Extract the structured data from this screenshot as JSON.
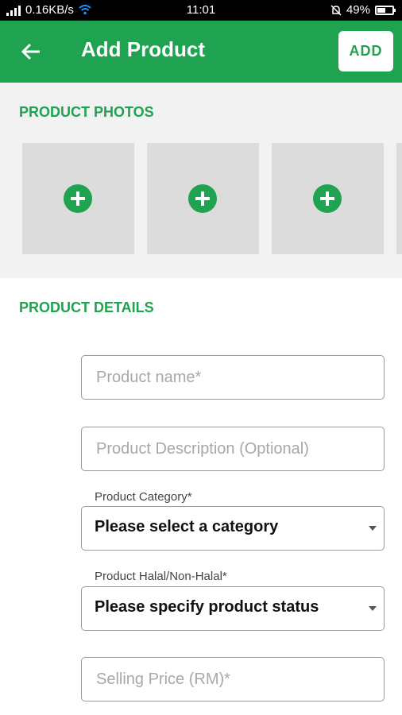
{
  "status_bar": {
    "network_speed": "0.16KB/s",
    "time": "11:01",
    "battery": "49%"
  },
  "app_bar": {
    "title": "Add Product",
    "add_label": "ADD",
    "back_icon": "arrow-left-icon"
  },
  "photos": {
    "heading": "PRODUCT PHOTOS",
    "add_icon": "plus-circle-icon"
  },
  "details": {
    "heading": "PRODUCT DETAILS",
    "product_name_placeholder": "Product name*",
    "description_placeholder": "Product Description (Optional)",
    "category_label": "Product Category*",
    "category_value": "Please select a category",
    "halal_label": "Product Halal/Non-Halal*",
    "halal_value": "Please specify product status",
    "price_placeholder": "Selling Price (RM)*"
  },
  "colors": {
    "accent": "#1fa351",
    "photo_slot": "#dcdcdc",
    "section_bg": "#f2f2f2"
  }
}
